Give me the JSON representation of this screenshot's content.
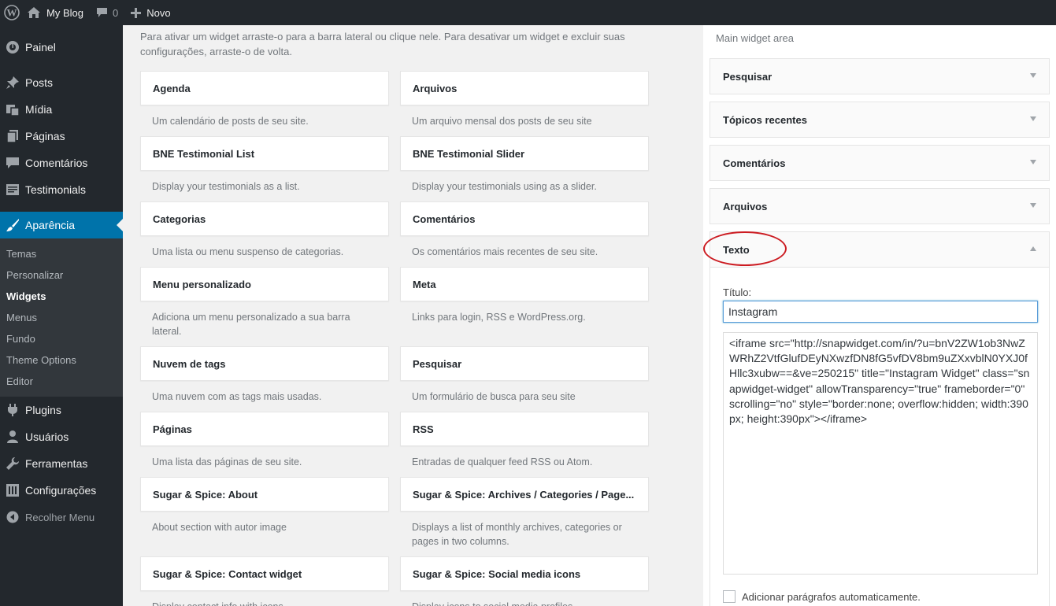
{
  "adminbar": {
    "site_name": "My Blog",
    "comments_count": "0",
    "new_label": "Novo"
  },
  "menu": {
    "items_top": [
      {
        "label": "Painel",
        "icon": "dashboard-icon"
      }
    ],
    "items_mid": [
      {
        "label": "Posts",
        "icon": "pin-icon"
      },
      {
        "label": "Mídia",
        "icon": "media-icon"
      },
      {
        "label": "Páginas",
        "icon": "pages-icon"
      },
      {
        "label": "Comentários",
        "icon": "comment-icon"
      },
      {
        "label": "Testimonials",
        "icon": "testimonials-icon"
      }
    ],
    "current": {
      "label": "Aparência",
      "icon": "brush-icon"
    },
    "submenu": [
      "Temas",
      "Personalizar",
      "Widgets",
      "Menus",
      "Fundo",
      "Theme Options",
      "Editor"
    ],
    "submenu_active": "Widgets",
    "items_bottom": [
      {
        "label": "Plugins",
        "icon": "plugin-icon"
      },
      {
        "label": "Usuários",
        "icon": "users-icon"
      },
      {
        "label": "Ferramentas",
        "icon": "wrench-icon"
      },
      {
        "label": "Configurações",
        "icon": "settings-icon"
      }
    ],
    "collapse_label": "Recolher Menu"
  },
  "main": {
    "intro": "Para ativar um widget arraste-o para a barra lateral ou clique nele. Para desativar um widget e excluir suas configurações, arraste-o de volta.",
    "widgets": [
      {
        "title": "Agenda",
        "desc": "Um calendário de posts de seu site."
      },
      {
        "title": "Arquivos",
        "desc": "Um arquivo mensal dos posts de seu site"
      },
      {
        "title": "BNE Testimonial List",
        "desc": "Display your testimonials as a list."
      },
      {
        "title": "BNE Testimonial Slider",
        "desc": "Display your testimonials using as a slider."
      },
      {
        "title": "Categorias",
        "desc": "Uma lista ou menu suspenso de categorias."
      },
      {
        "title": "Comentários",
        "desc": "Os comentários mais recentes de seu site."
      },
      {
        "title": "Menu personalizado",
        "desc": "Adiciona um menu personalizado a sua barra lateral."
      },
      {
        "title": "Meta",
        "desc": "Links para login, RSS e WordPress.org."
      },
      {
        "title": "Nuvem de tags",
        "desc": "Uma nuvem com as tags mais usadas."
      },
      {
        "title": "Pesquisar",
        "desc": "Um formulário de busca para seu site"
      },
      {
        "title": "Páginas",
        "desc": "Uma lista das páginas de seu site."
      },
      {
        "title": "RSS",
        "desc": "Entradas de qualquer feed RSS ou Atom."
      },
      {
        "title": "Sugar & Spice: About",
        "desc": "About section with autor image"
      },
      {
        "title": "Sugar & Spice: Archives / Categories / Page...",
        "desc": "Displays a list of monthly archives, categories or pages in two columns."
      },
      {
        "title": "Sugar & Spice: Contact widget",
        "desc": "Display contact info with icons"
      },
      {
        "title": "Sugar & Spice: Social media icons",
        "desc": "Display icons to social media profiles"
      }
    ]
  },
  "sidebar": {
    "area_title": "Main widget area",
    "widgets": [
      "Pesquisar",
      "Tópicos recentes",
      "Comentários",
      "Arquivos",
      "Texto"
    ],
    "open_widget": {
      "title_label": "Título:",
      "title_value": "Instagram",
      "text_value": "<iframe src=\"http://snapwidget.com/in/?u=bnV2ZW1ob3NwZWRhZ2VtfGlufDEyNXwzfDN8fG5vfDV8bm9uZXxvblN0YXJ0fHllc3xubw==&ve=250215\" title=\"Instagram Widget\" class=\"snapwidget-widget\" allowTransparency=\"true\" frameborder=\"0\" scrolling=\"no\" style=\"border:none; overflow:hidden; width:390px; height:390px\"></iframe>",
      "autop_label": "Adicionar parágrafos automaticamente."
    }
  }
}
